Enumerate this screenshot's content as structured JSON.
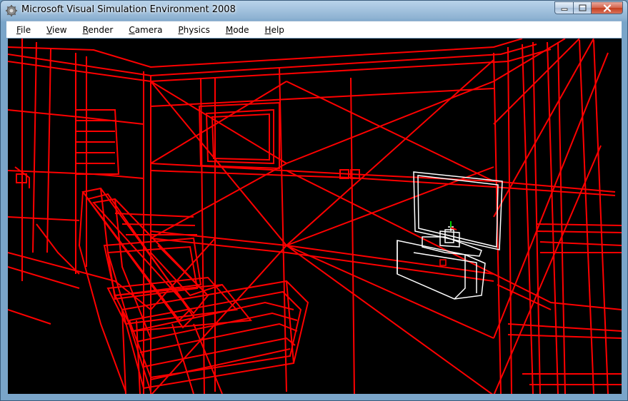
{
  "window": {
    "title": "Microsoft Visual Simulation Environment 2008",
    "icon": "app-gear-icon"
  },
  "caption_buttons": {
    "minimize_icon": "minimize-icon",
    "maximize_icon": "maximize-icon",
    "close_icon": "close-icon"
  },
  "menu": [
    {
      "label": "File",
      "key": "F",
      "rest": "ile"
    },
    {
      "label": "View",
      "key": "V",
      "rest": "iew"
    },
    {
      "label": "Render",
      "key": "R",
      "rest": "ender"
    },
    {
      "label": "Camera",
      "key": "C",
      "rest": "amera"
    },
    {
      "label": "Physics",
      "key": "P",
      "rest": "hysics"
    },
    {
      "label": "Mode",
      "key": "M",
      "rest": "ode"
    },
    {
      "label": "Help",
      "key": "H",
      "rest": "elp"
    }
  ],
  "viewport": {
    "render_mode": "wireframe",
    "background": "#000000",
    "scene_color": "#ff0000",
    "robot_color": "#ffffff"
  }
}
